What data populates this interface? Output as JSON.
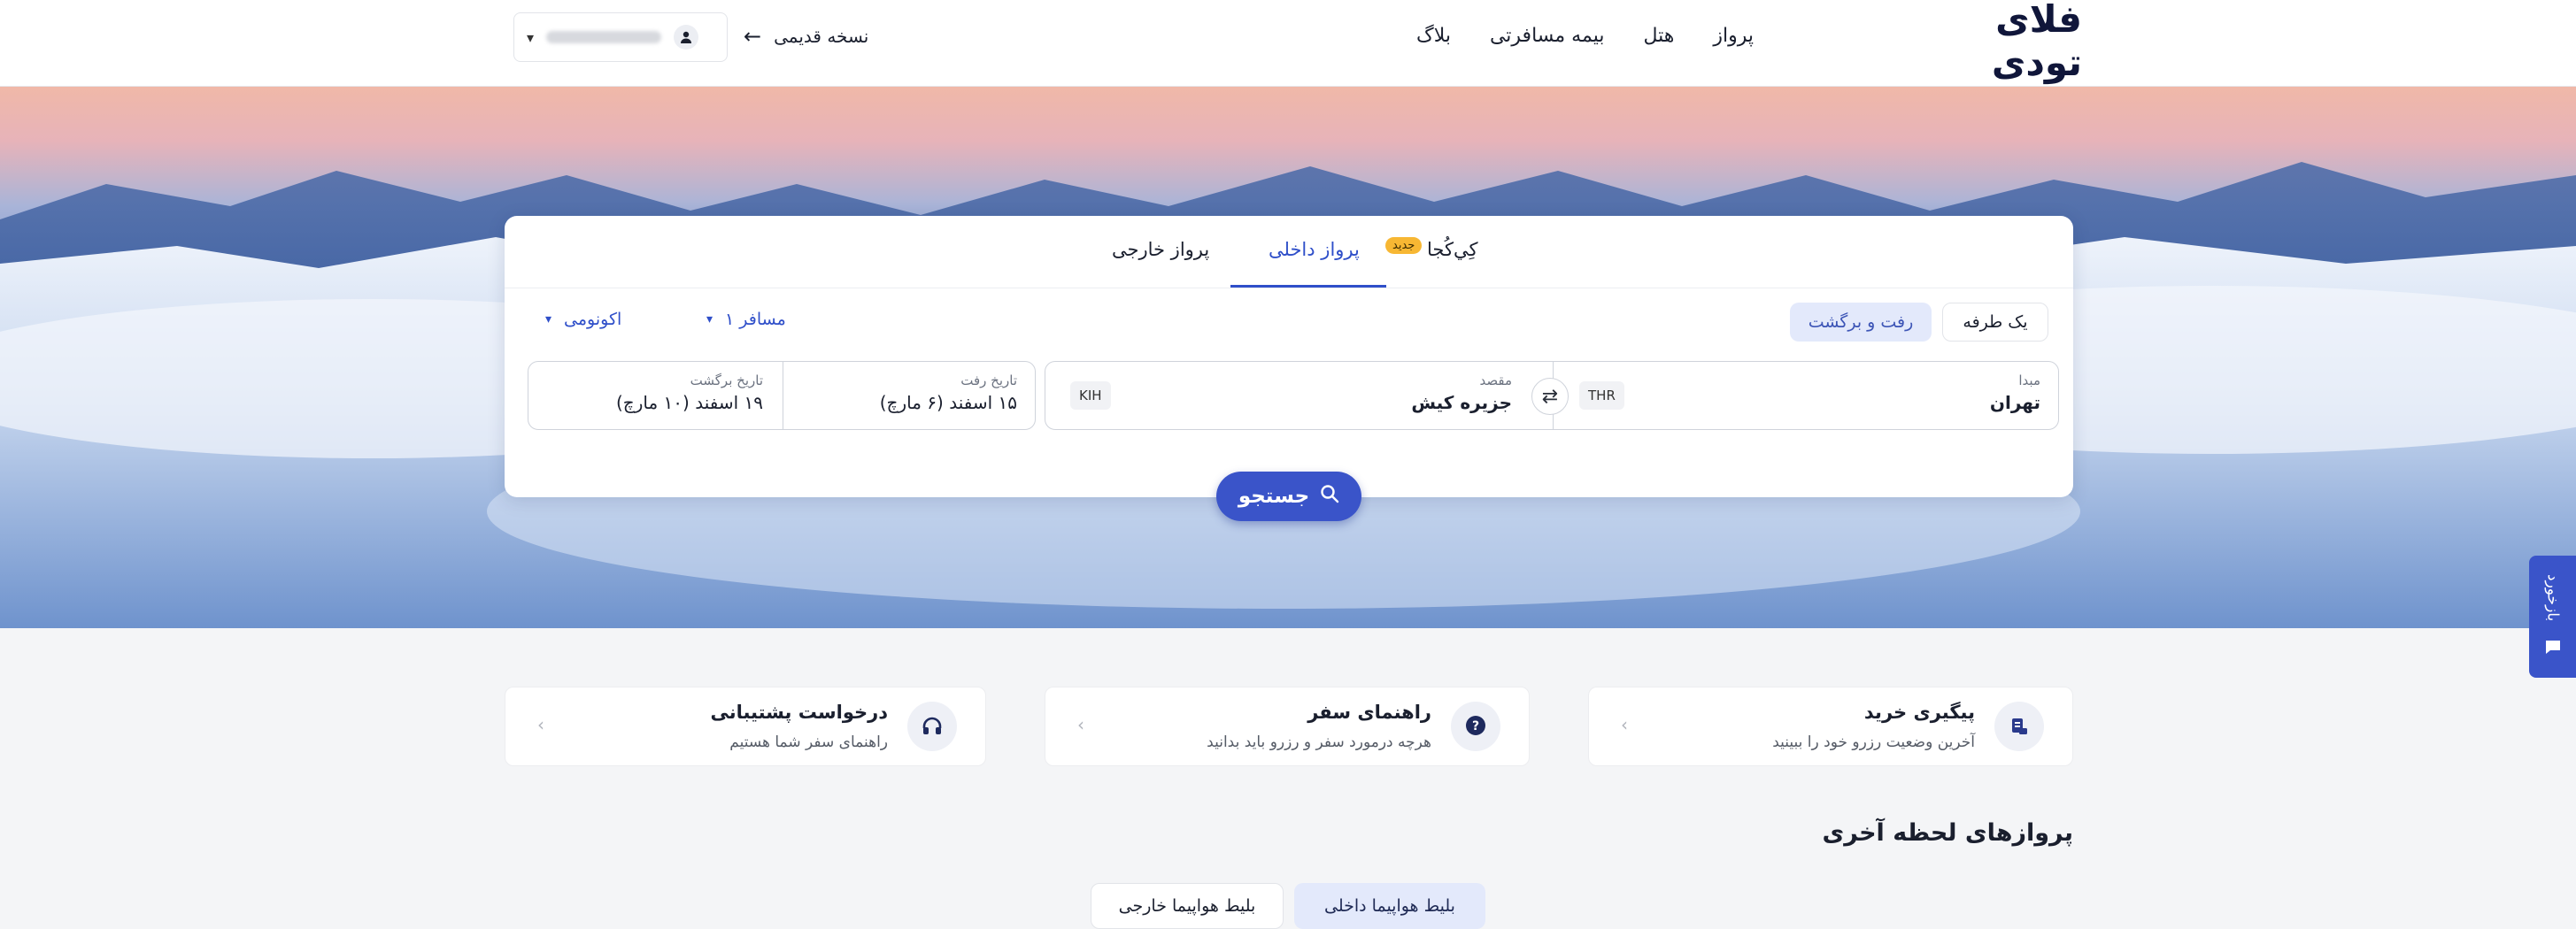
{
  "header": {
    "logo": "فلای تودی",
    "nav": [
      "پرواز",
      "هتل",
      "بیمه مسافرتی",
      "بلاگ"
    ],
    "old_version": "نسخه قدیمی",
    "account_name": "09•••••22"
  },
  "search": {
    "tabs": {
      "kojaa": "کِي‌کُجا",
      "kojaa_badge": "جدید",
      "domestic": "پرواز داخلی",
      "international": "پرواز خارجی"
    },
    "trip_type": {
      "one_way": "یک طرفه",
      "round_trip": "رفت و برگشت"
    },
    "passengers": "۱ مسافر",
    "cabin_class": "اکونومی",
    "origin": {
      "label": "مبدا",
      "city": "تهران",
      "code": "THR"
    },
    "destination": {
      "label": "مقصد",
      "city": "جزیره کیش",
      "code": "KIH"
    },
    "departure": {
      "label": "تاریخ رفت",
      "value": "۱۵ اسفند (۶ مارچ)"
    },
    "return": {
      "label": "تاریخ برگشت",
      "value": "۱۹ اسفند (۱۰ مارچ)"
    },
    "button": "جستجو"
  },
  "feedback": "بازخورد",
  "info_cards": [
    {
      "title": "پیگیری خرید",
      "subtitle": "آخرین وضعیت رزرو خود را ببینید",
      "icon": "receipt-icon"
    },
    {
      "title": "راهنمای سفر",
      "subtitle": "هرچه درمورد سفر و رزرو باید بدانید",
      "icon": "question-icon"
    },
    {
      "title": "درخواست پشتیبانی",
      "subtitle": "راهنمای سفر شما هستیم",
      "icon": "headset-icon"
    }
  ],
  "last_minute": {
    "title": "پروازهای لحظه آخری",
    "tabs": [
      "بلیط هواپیما داخلی",
      "بلیط هواپیما خارجی"
    ]
  },
  "colors": {
    "primary": "#3a54c9",
    "badge": "#f7b733",
    "tab_active_bg": "#e3e9fb"
  }
}
